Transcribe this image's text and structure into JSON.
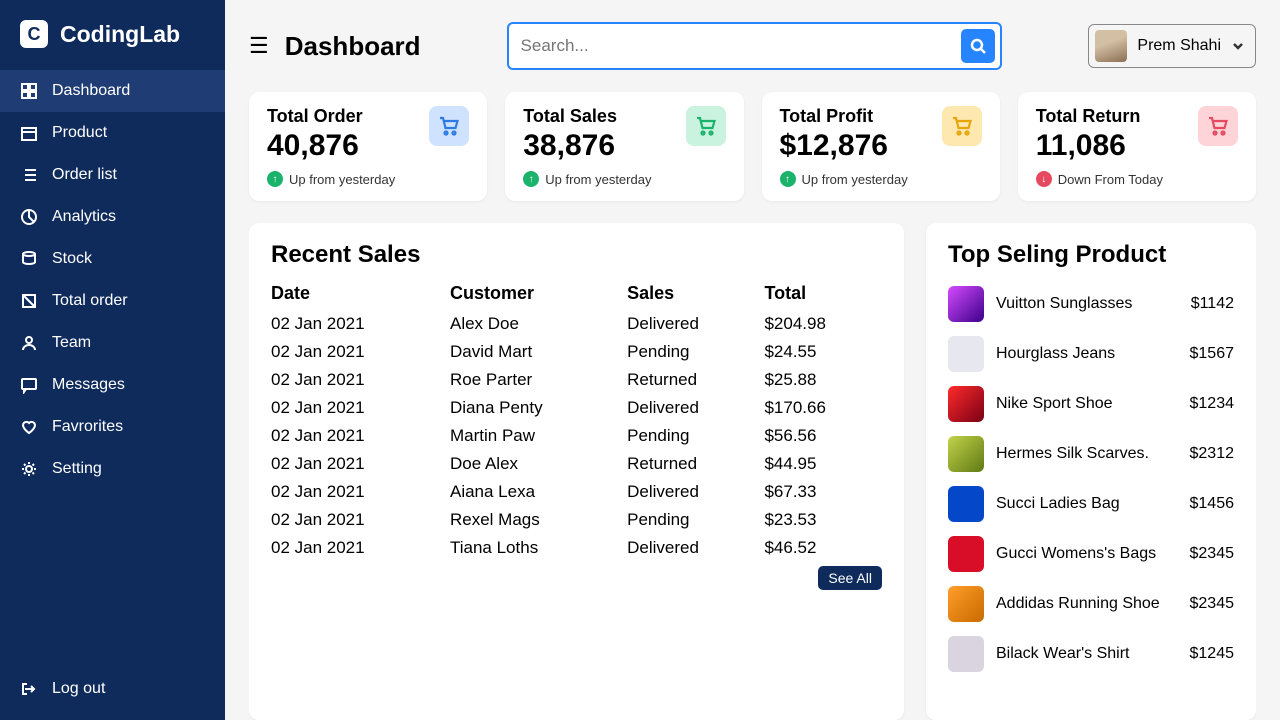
{
  "brand": "CodingLab",
  "sidebar": {
    "items": [
      {
        "label": "Dashboard",
        "icon": "dashboard",
        "active": true
      },
      {
        "label": "Product",
        "icon": "box"
      },
      {
        "label": "Order list",
        "icon": "list"
      },
      {
        "label": "Analytics",
        "icon": "pie"
      },
      {
        "label": "Stock",
        "icon": "stack"
      },
      {
        "label": "Total order",
        "icon": "book"
      },
      {
        "label": "Team",
        "icon": "user"
      },
      {
        "label": "Messages",
        "icon": "message"
      },
      {
        "label": "Favrorites",
        "icon": "heart"
      },
      {
        "label": "Setting",
        "icon": "gear"
      }
    ],
    "logout_label": "Log out"
  },
  "header": {
    "page_title": "Dashboard",
    "search_placeholder": "Search...",
    "user_name": "Prem Shahi"
  },
  "cards": [
    {
      "title": "Total Order",
      "value": "40,876",
      "status": "Up from yesterday",
      "dir": "up",
      "icon_color": "blue"
    },
    {
      "title": "Total Sales",
      "value": "38,876",
      "status": "Up from yesterday",
      "dir": "up",
      "icon_color": "green"
    },
    {
      "title": "Total Profit",
      "value": "$12,876",
      "status": "Up from yesterday",
      "dir": "up",
      "icon_color": "yellow"
    },
    {
      "title": "Total Return",
      "value": "11,086",
      "status": "Down From Today",
      "dir": "down",
      "icon_color": "red"
    }
  ],
  "recent_sales": {
    "title": "Recent Sales",
    "headers": {
      "date": "Date",
      "customer": "Customer",
      "sales": "Sales",
      "total": "Total"
    },
    "rows": [
      {
        "date": "02 Jan 2021",
        "customer": "Alex Doe",
        "sales": "Delivered",
        "total": "$204.98"
      },
      {
        "date": "02 Jan 2021",
        "customer": "David Mart",
        "sales": "Pending",
        "total": "$24.55"
      },
      {
        "date": "02 Jan 2021",
        "customer": "Roe Parter",
        "sales": "Returned",
        "total": "$25.88"
      },
      {
        "date": "02 Jan 2021",
        "customer": "Diana Penty",
        "sales": "Delivered",
        "total": "$170.66"
      },
      {
        "date": "02 Jan 2021",
        "customer": "Martin Paw",
        "sales": "Pending",
        "total": "$56.56"
      },
      {
        "date": "02 Jan 2021",
        "customer": "Doe Alex",
        "sales": "Returned",
        "total": "$44.95"
      },
      {
        "date": "02 Jan 2021",
        "customer": "Aiana Lexa",
        "sales": "Delivered",
        "total": "$67.33"
      },
      {
        "date": "02 Jan 2021",
        "customer": "Rexel Mags",
        "sales": "Pending",
        "total": "$23.53"
      },
      {
        "date": "02 Jan 2021",
        "customer": "Tiana Loths",
        "sales": "Delivered",
        "total": "$46.52"
      }
    ],
    "see_all": "See All"
  },
  "top_products": {
    "title": "Top Seling Product",
    "items": [
      {
        "name": "Vuitton Sunglasses",
        "price": "$1142"
      },
      {
        "name": "Hourglass Jeans",
        "price": "$1567"
      },
      {
        "name": "Nike Sport Shoe",
        "price": "$1234"
      },
      {
        "name": "Hermes Silk Scarves.",
        "price": "$2312"
      },
      {
        "name": "Succi Ladies Bag",
        "price": "$1456"
      },
      {
        "name": "Gucci Womens's Bags",
        "price": "$2345"
      },
      {
        "name": "Addidas Running Shoe",
        "price": "$2345"
      },
      {
        "name": "Bilack Wear's Shirt",
        "price": "$1245"
      }
    ]
  }
}
